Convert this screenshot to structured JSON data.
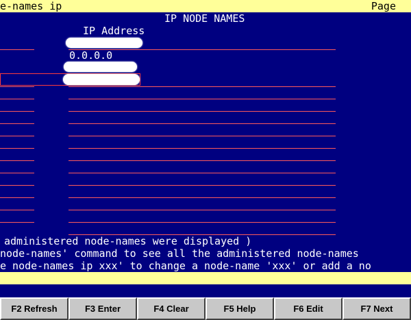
{
  "header": {
    "command": "e-names ip",
    "page_label": "Page"
  },
  "screen": {
    "title": "IP NODE NAMES",
    "column_ip_address": "IP Address",
    "rows": [
      {
        "ip": ""
      },
      {
        "ip": "0.0.0.0"
      },
      {
        "ip": ""
      },
      {
        "ip": ""
      }
    ]
  },
  "messages": {
    "line1": "administered node-names were displayed )",
    "line2": "node-names' command to see all the administered node-names",
    "line3": "e node-names ip xxx' to change a node-name 'xxx' or add a no"
  },
  "function_keys": [
    {
      "label": "F2 Refresh"
    },
    {
      "label": "F3 Enter"
    },
    {
      "label": "F4 Clear"
    },
    {
      "label": "F5 Help"
    },
    {
      "label": "F6 Edit"
    },
    {
      "label": "F7 Next"
    }
  ],
  "colors": {
    "background": "#000080",
    "status_bar": "#ffff99",
    "field_underline": "#ff5a5a"
  }
}
